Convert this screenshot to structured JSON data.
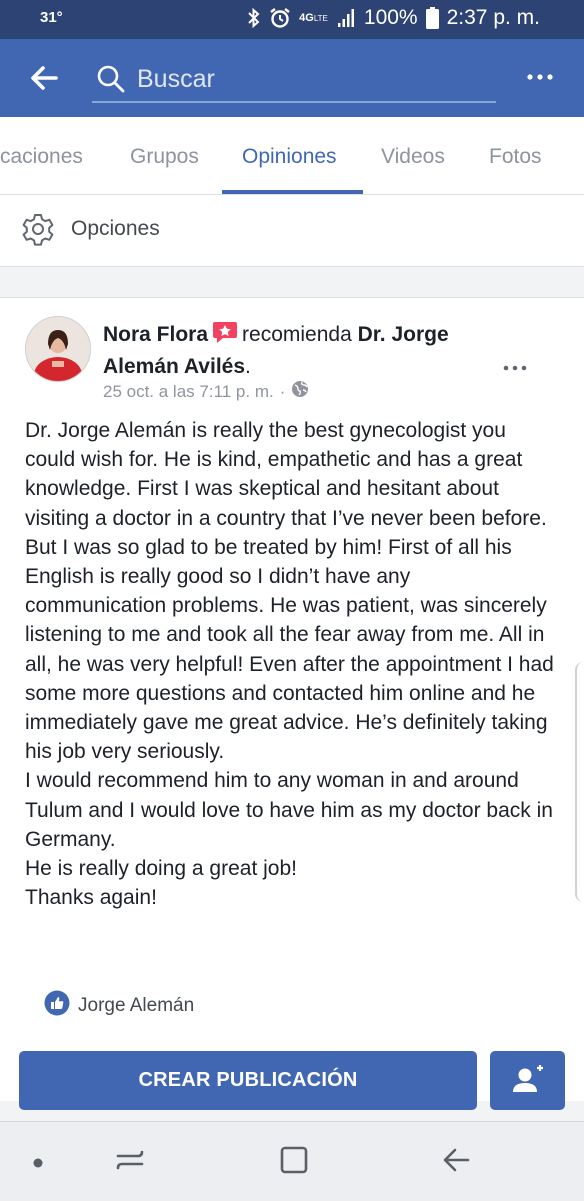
{
  "status_bar": {
    "temperature": "31°",
    "network_top": "4G",
    "network_sub": "LTE",
    "battery": "100%",
    "time": "2:37 p. m."
  },
  "header": {
    "search_placeholder": "Buscar"
  },
  "tabs": [
    {
      "label": "caciones",
      "active": false
    },
    {
      "label": "Grupos",
      "active": false
    },
    {
      "label": "Opiniones",
      "active": true
    },
    {
      "label": "Videos",
      "active": false
    },
    {
      "label": "Fotos",
      "active": false
    }
  ],
  "options": {
    "label": "Opciones",
    "icon": "gear-icon"
  },
  "post": {
    "author": "Nora Flora",
    "verb": "recomienda",
    "page_name": "Dr. Jorge Alemán Avilés",
    "timestamp": "25 oct. a las 7:11 p. m.",
    "separator": "·",
    "body": "Dr. Jorge Alemán is really the best gynecologist you could wish for. He is kind, empathetic and has a great knowledge. First I was skeptical and hesitant about visiting a doctor in a country that I’ve never been before. But I was so glad to be treated by him! First of all his English is really good so I didn’t have any communication problems. He was patient, was sincerely listening to me and took all the fear away from me. All in all, he was very helpful! Even after the appointment I had some more questions and contacted him online and he immediately gave me great advice. He’s definitely taking his job very seriously.\nI would recommend him to any woman in and around Tulum and I would love to have him as my doctor back in Germany.\nHe is really doing a great job!\nThanks again!",
    "liked_by": "Jorge Alemán"
  },
  "actions": {
    "create_post_label": "CREAR PUBLICACIÓN"
  },
  "colors": {
    "brand": "#4267b2",
    "status_bar": "#2d4373",
    "recommend_badge": "#f3425f"
  }
}
